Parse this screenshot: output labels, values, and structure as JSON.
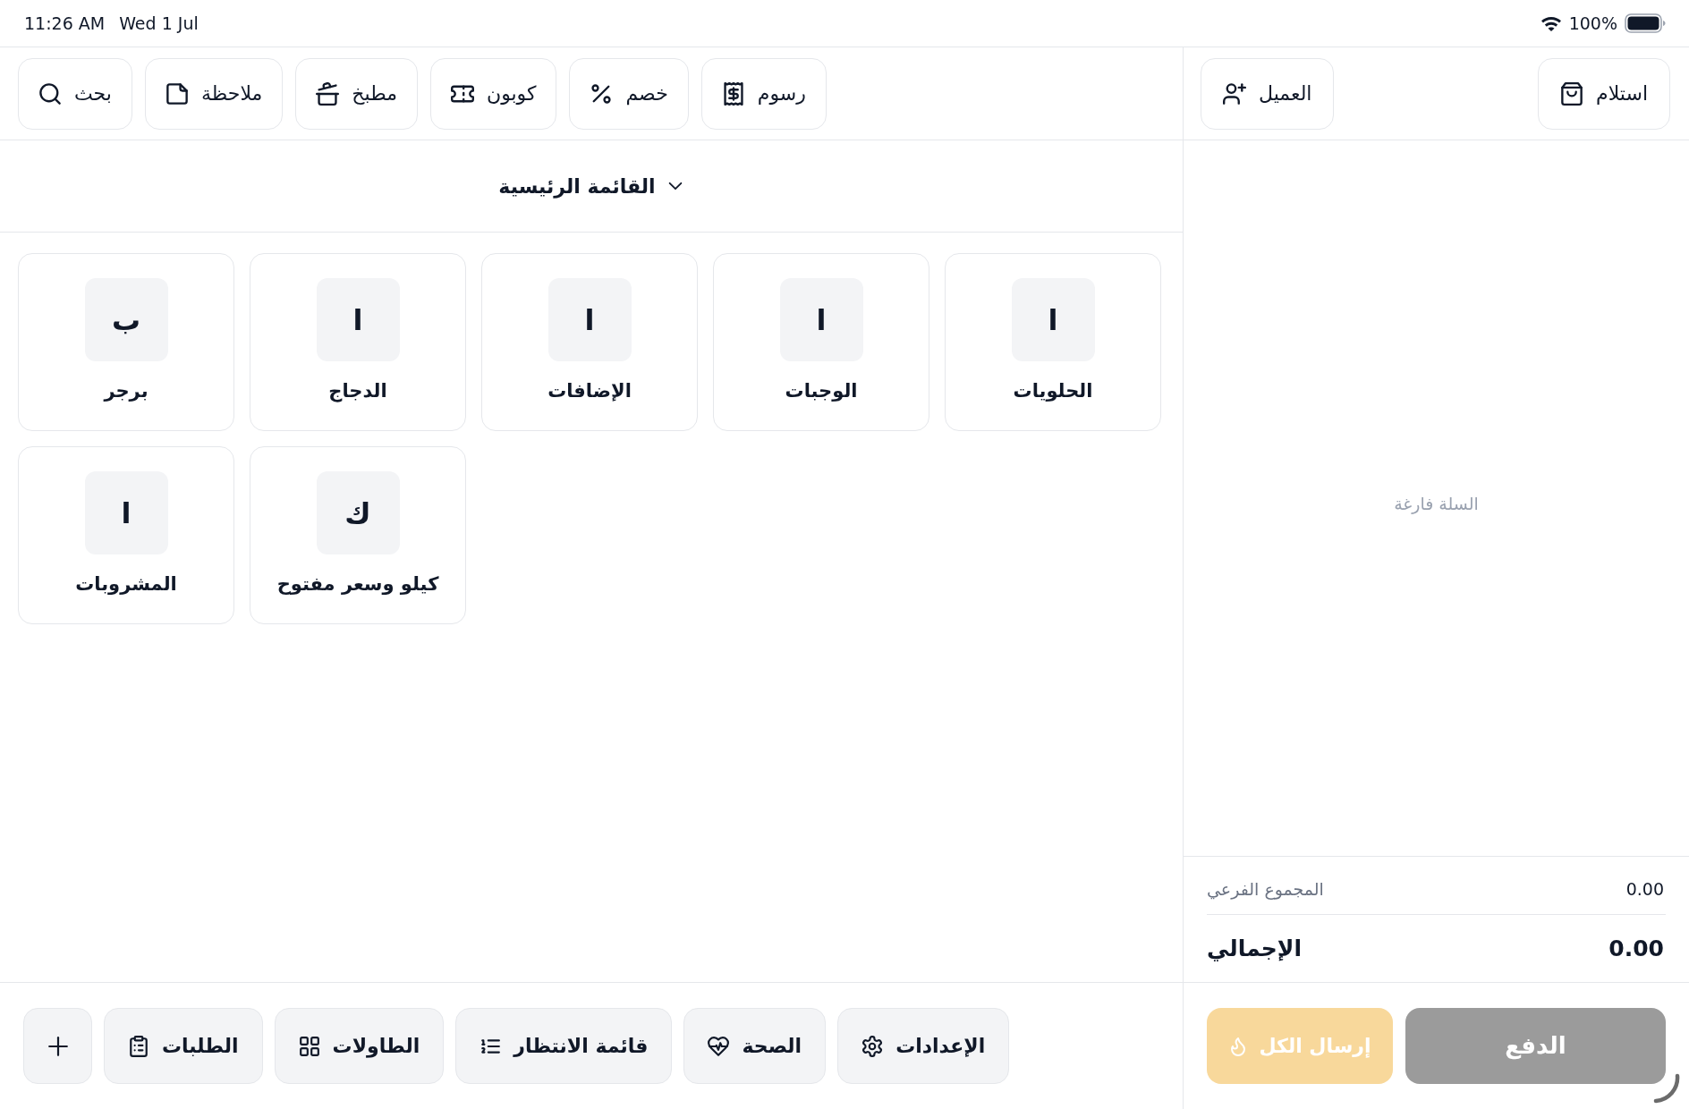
{
  "status_bar": {
    "time": "11:26 AM",
    "date": "Wed 1 Jul",
    "battery": "100%"
  },
  "toolbar": {
    "actions": [
      {
        "kind": "fees",
        "label": "رسوم"
      },
      {
        "kind": "discount",
        "label": "خصم"
      },
      {
        "kind": "coupon",
        "label": "كوبون"
      },
      {
        "kind": "kitchen",
        "label": "مطبخ"
      },
      {
        "kind": "note",
        "label": "ملاحظة"
      },
      {
        "kind": "search",
        "label": "بحث"
      }
    ]
  },
  "menu_selector": {
    "label": "القائمة الرئيسية"
  },
  "categories": [
    {
      "initial": "ا",
      "name": "الحلويات"
    },
    {
      "initial": "ا",
      "name": "الوجبات"
    },
    {
      "initial": "ا",
      "name": "الإضافات"
    },
    {
      "initial": "ا",
      "name": "الدجاج"
    },
    {
      "initial": "ب",
      "name": "برجر"
    },
    {
      "initial": "ك",
      "name": "كيلو وسعر مفتوح"
    },
    {
      "initial": "ا",
      "name": "المشروبات"
    }
  ],
  "bottom_bar": {
    "actions": [
      {
        "kind": "settings",
        "label": "الإعدادات"
      },
      {
        "kind": "health",
        "label": "الصحة"
      },
      {
        "kind": "waitlist",
        "label": "قائمة الانتظار"
      },
      {
        "kind": "tables",
        "label": "الطاولات"
      },
      {
        "kind": "orders",
        "label": "الطلبات"
      },
      {
        "kind": "add"
      }
    ]
  },
  "cart": {
    "header_actions": [
      {
        "kind": "pickup",
        "label": "استلام"
      },
      {
        "kind": "customer",
        "label": "العميل"
      }
    ],
    "empty_message": "السلة فارغة",
    "subtotal": {
      "label": "المجموع الفرعي",
      "value": "0.00"
    },
    "total": {
      "label": "الإجمالي",
      "value": "0.00"
    },
    "actions": [
      {
        "kind": "pay",
        "label": "الدفع",
        "disabled": true
      },
      {
        "kind": "send",
        "label": "إرسال الكل",
        "disabled": true
      }
    ]
  }
}
